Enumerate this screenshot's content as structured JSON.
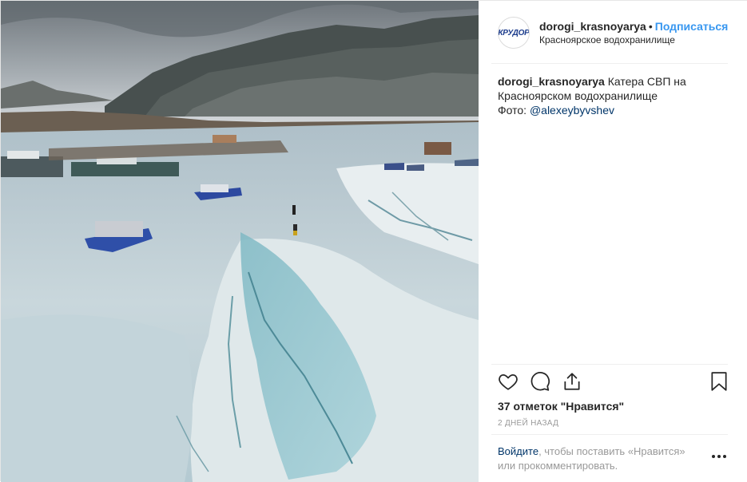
{
  "post": {
    "photo_alt": "",
    "header": {
      "avatar_text": "КРУДОР",
      "username": "dorogi_krasnoyarya",
      "separator": "•",
      "follow_label": "Подписаться",
      "location": "Красноярское водохранилище"
    },
    "caption": {
      "username": "dorogi_krasnoyarya",
      "text": "Катера СВП на Красноярском водохранилище",
      "photo_prefix": "Фото:",
      "mention": "@alexeybyvshev"
    },
    "actions": {
      "like_icon": "heart-icon",
      "comment_icon": "comment-icon",
      "share_icon": "share-icon",
      "save_icon": "bookmark-icon"
    },
    "likes_text": "37 отметок \"Нравится\"",
    "date_text": "2 ДНЕЙ НАЗАД",
    "login": {
      "link_text": "Войдите",
      "rest_text": ", чтобы поставить «Нравится» или прокомментировать."
    },
    "more_icon": "more-options-icon",
    "colors": {
      "link_blue": "#3897f0",
      "mention_blue": "#003569",
      "muted_gray": "#999999",
      "border": "#efefef"
    }
  }
}
